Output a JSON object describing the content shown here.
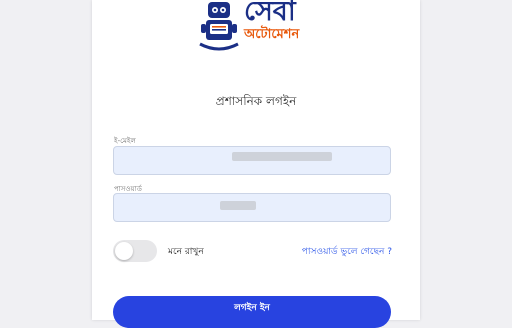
{
  "logo": {
    "title_text": "সেবা",
    "subtitle_text": "অটোমেশন",
    "colors": {
      "primary": "#1b2f86",
      "accent": "#e8590c"
    }
  },
  "page_title": "প্রশাসনিক লগইন",
  "email": {
    "label": "ই-মেইল",
    "value": ""
  },
  "password": {
    "label": "পাসওয়ার্ড",
    "value": ""
  },
  "remember": {
    "label": "মনে রাখুন",
    "checked": false
  },
  "forgot_link": "পাসওয়ার্ড ভুলে গেছেন ?",
  "login_button": "লগইন ইন",
  "colors": {
    "button": "#2843e0",
    "link": "#2b55e8",
    "input_bg": "#e8effd"
  }
}
